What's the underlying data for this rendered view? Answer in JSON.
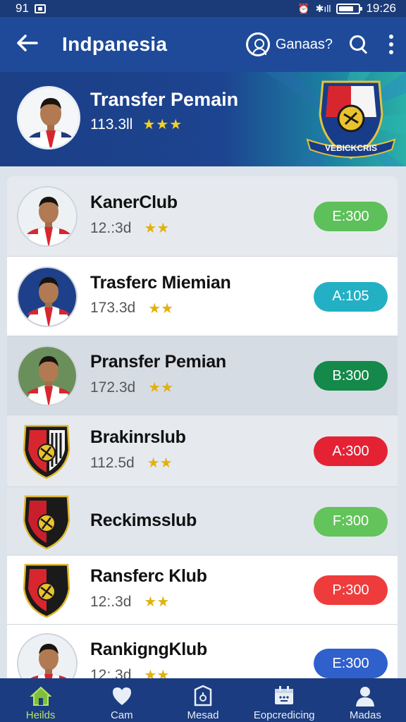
{
  "status_bar": {
    "left_text": "91",
    "time": "19:26"
  },
  "app_bar": {
    "title": "Indpanesia",
    "account_label": "Ganaas?"
  },
  "banner": {
    "title": "Transfer Pemain",
    "subtitle": "113.3ll",
    "stars": "★★★",
    "crest_text": "VEBICKCRIS"
  },
  "rows": [
    {
      "name": "KanerClub",
      "meta": "12.:3d",
      "stars": "★★",
      "badge": "E:300",
      "badge_color": "#5dc05a",
      "kind": "player"
    },
    {
      "name": "Trasferc Miemian",
      "meta": "173.3d",
      "stars": "★★",
      "badge": "A:105",
      "badge_color": "#23b0c4",
      "kind": "player"
    },
    {
      "name": "Pransfer Pemian",
      "meta": "172.3d",
      "stars": "★★",
      "badge": "B:300",
      "badge_color": "#14894a",
      "kind": "player"
    },
    {
      "name": "Brakinrslub",
      "meta": "112.5d",
      "stars": "★★",
      "badge": "A:300",
      "badge_color": "#e42234",
      "kind": "crest"
    },
    {
      "name": "Reckimsslub",
      "meta": "",
      "stars": "",
      "badge": "F:300",
      "badge_color": "#62c45a",
      "kind": "crest"
    },
    {
      "name": "Ransferc Klub",
      "meta": "12:.3d",
      "stars": "★★",
      "badge": "P:300",
      "badge_color": "#ee3c3c",
      "kind": "crest"
    },
    {
      "name": "RankigngKlub",
      "meta": "12:.3d",
      "stars": "★★",
      "badge": "E:300",
      "badge_color": "#2f60cc",
      "kind": "player"
    }
  ],
  "bottom_nav": [
    {
      "label": "Heilds",
      "icon": "home-icon",
      "active": true
    },
    {
      "label": "Cam",
      "icon": "heart-icon",
      "active": false
    },
    {
      "label": "Mesad",
      "icon": "shield-icon",
      "active": false
    },
    {
      "label": "Eopcredicing",
      "icon": "calendar-icon",
      "active": false
    },
    {
      "label": "Madas",
      "icon": "user-icon",
      "active": false
    }
  ],
  "colors": {
    "primary": "#1f4a9a",
    "star": "#e1b10f",
    "active_nav": "#b7e36a"
  }
}
